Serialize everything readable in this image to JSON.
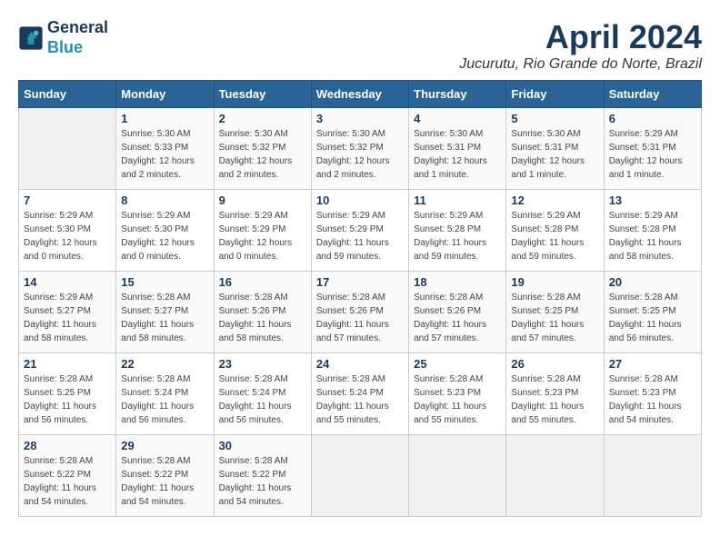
{
  "logo": {
    "line1": "General",
    "line2": "Blue"
  },
  "title": "April 2024",
  "location": "Jucurutu, Rio Grande do Norte, Brazil",
  "days_of_week": [
    "Sunday",
    "Monday",
    "Tuesday",
    "Wednesday",
    "Thursday",
    "Friday",
    "Saturday"
  ],
  "weeks": [
    [
      {
        "day": "",
        "info": ""
      },
      {
        "day": "1",
        "info": "Sunrise: 5:30 AM\nSunset: 5:33 PM\nDaylight: 12 hours\nand 2 minutes."
      },
      {
        "day": "2",
        "info": "Sunrise: 5:30 AM\nSunset: 5:32 PM\nDaylight: 12 hours\nand 2 minutes."
      },
      {
        "day": "3",
        "info": "Sunrise: 5:30 AM\nSunset: 5:32 PM\nDaylight: 12 hours\nand 2 minutes."
      },
      {
        "day": "4",
        "info": "Sunrise: 5:30 AM\nSunset: 5:31 PM\nDaylight: 12 hours\nand 1 minute."
      },
      {
        "day": "5",
        "info": "Sunrise: 5:30 AM\nSunset: 5:31 PM\nDaylight: 12 hours\nand 1 minute."
      },
      {
        "day": "6",
        "info": "Sunrise: 5:29 AM\nSunset: 5:31 PM\nDaylight: 12 hours\nand 1 minute."
      }
    ],
    [
      {
        "day": "7",
        "info": "Sunrise: 5:29 AM\nSunset: 5:30 PM\nDaylight: 12 hours\nand 0 minutes."
      },
      {
        "day": "8",
        "info": "Sunrise: 5:29 AM\nSunset: 5:30 PM\nDaylight: 12 hours\nand 0 minutes."
      },
      {
        "day": "9",
        "info": "Sunrise: 5:29 AM\nSunset: 5:29 PM\nDaylight: 12 hours\nand 0 minutes."
      },
      {
        "day": "10",
        "info": "Sunrise: 5:29 AM\nSunset: 5:29 PM\nDaylight: 11 hours\nand 59 minutes."
      },
      {
        "day": "11",
        "info": "Sunrise: 5:29 AM\nSunset: 5:28 PM\nDaylight: 11 hours\nand 59 minutes."
      },
      {
        "day": "12",
        "info": "Sunrise: 5:29 AM\nSunset: 5:28 PM\nDaylight: 11 hours\nand 59 minutes."
      },
      {
        "day": "13",
        "info": "Sunrise: 5:29 AM\nSunset: 5:28 PM\nDaylight: 11 hours\nand 58 minutes."
      }
    ],
    [
      {
        "day": "14",
        "info": "Sunrise: 5:29 AM\nSunset: 5:27 PM\nDaylight: 11 hours\nand 58 minutes."
      },
      {
        "day": "15",
        "info": "Sunrise: 5:28 AM\nSunset: 5:27 PM\nDaylight: 11 hours\nand 58 minutes."
      },
      {
        "day": "16",
        "info": "Sunrise: 5:28 AM\nSunset: 5:26 PM\nDaylight: 11 hours\nand 58 minutes."
      },
      {
        "day": "17",
        "info": "Sunrise: 5:28 AM\nSunset: 5:26 PM\nDaylight: 11 hours\nand 57 minutes."
      },
      {
        "day": "18",
        "info": "Sunrise: 5:28 AM\nSunset: 5:26 PM\nDaylight: 11 hours\nand 57 minutes."
      },
      {
        "day": "19",
        "info": "Sunrise: 5:28 AM\nSunset: 5:25 PM\nDaylight: 11 hours\nand 57 minutes."
      },
      {
        "day": "20",
        "info": "Sunrise: 5:28 AM\nSunset: 5:25 PM\nDaylight: 11 hours\nand 56 minutes."
      }
    ],
    [
      {
        "day": "21",
        "info": "Sunrise: 5:28 AM\nSunset: 5:25 PM\nDaylight: 11 hours\nand 56 minutes."
      },
      {
        "day": "22",
        "info": "Sunrise: 5:28 AM\nSunset: 5:24 PM\nDaylight: 11 hours\nand 56 minutes."
      },
      {
        "day": "23",
        "info": "Sunrise: 5:28 AM\nSunset: 5:24 PM\nDaylight: 11 hours\nand 56 minutes."
      },
      {
        "day": "24",
        "info": "Sunrise: 5:28 AM\nSunset: 5:24 PM\nDaylight: 11 hours\nand 55 minutes."
      },
      {
        "day": "25",
        "info": "Sunrise: 5:28 AM\nSunset: 5:23 PM\nDaylight: 11 hours\nand 55 minutes."
      },
      {
        "day": "26",
        "info": "Sunrise: 5:28 AM\nSunset: 5:23 PM\nDaylight: 11 hours\nand 55 minutes."
      },
      {
        "day": "27",
        "info": "Sunrise: 5:28 AM\nSunset: 5:23 PM\nDaylight: 11 hours\nand 54 minutes."
      }
    ],
    [
      {
        "day": "28",
        "info": "Sunrise: 5:28 AM\nSunset: 5:22 PM\nDaylight: 11 hours\nand 54 minutes."
      },
      {
        "day": "29",
        "info": "Sunrise: 5:28 AM\nSunset: 5:22 PM\nDaylight: 11 hours\nand 54 minutes."
      },
      {
        "day": "30",
        "info": "Sunrise: 5:28 AM\nSunset: 5:22 PM\nDaylight: 11 hours\nand 54 minutes."
      },
      {
        "day": "",
        "info": ""
      },
      {
        "day": "",
        "info": ""
      },
      {
        "day": "",
        "info": ""
      },
      {
        "day": "",
        "info": ""
      }
    ]
  ]
}
